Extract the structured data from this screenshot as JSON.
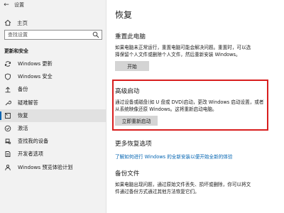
{
  "titlebar": {
    "title": "设置",
    "back_icon": "back-arrow-icon"
  },
  "sidebar": {
    "home_label": "主页",
    "search_placeholder": "查找设置",
    "section_label": "更新和安全",
    "items": [
      {
        "label": "Windows 更新",
        "icon": "sync-icon"
      },
      {
        "label": "Windows 安全",
        "icon": "shield-icon"
      },
      {
        "label": "备份",
        "icon": "backup-icon"
      },
      {
        "label": "疑难解答",
        "icon": "wrench-icon"
      },
      {
        "label": "恢复",
        "icon": "recovery-icon",
        "active": true
      },
      {
        "label": "激活",
        "icon": "check-circle-icon"
      },
      {
        "label": "查找我的设备",
        "icon": "find-device-icon"
      },
      {
        "label": "开发者选项",
        "icon": "developer-icon"
      },
      {
        "label": "Windows 预览体验计划",
        "icon": "insider-icon"
      }
    ]
  },
  "main": {
    "title": "恢复",
    "reset": {
      "heading": "重置此电脑",
      "desc_line1": "如果电脑未正常运行，重置电脑可能会解决问题。重置时，可以选",
      "desc_line2": "择保留个人文件或删除个人文件，然后重新安装 Windows。",
      "button": "开始"
    },
    "advanced": {
      "heading": "高级启动",
      "desc_line1": "通过设备或磁盘(如 U 盘或 DVD)启动，更改 Windows 启动设置，或者",
      "desc_line2": "从系统映像还原 Windows。这将重新启动电脑。",
      "button": "立即重新启动"
    },
    "more": {
      "heading": "更多恢复选项",
      "link": "了解如何进行 Windows 的全新安装以便开始全新的体验"
    },
    "backup": {
      "heading": "备份文件",
      "desc_line1": "如果电脑出现问题，通过原始文件丢失、损坏或删除，你可以将文",
      "desc_line2": "件通过备份方式通过其他方法恢复它们。"
    }
  },
  "colors": {
    "accent": "#0063b1",
    "highlight": "#d81e1e"
  }
}
